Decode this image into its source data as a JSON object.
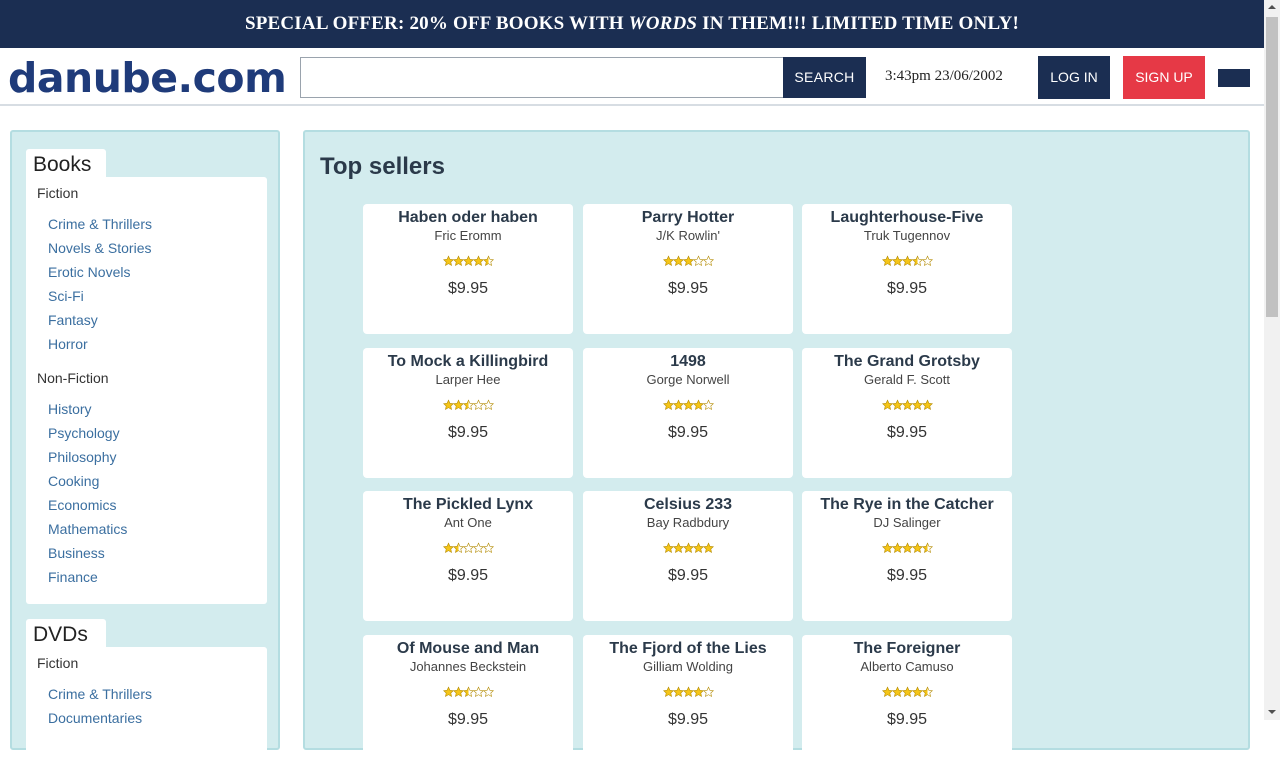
{
  "banner": {
    "pre": "SPECIAL OFFER: 20% OFF BOOKS WITH ",
    "emphasis": "WORDS",
    "post": " IN THEM!!! LIMITED TIME ONLY!"
  },
  "header": {
    "logo": "danube.com",
    "search_value": "",
    "search_button": "SEARCH",
    "clock": "3:43pm 23/06/2002",
    "login": "LOG IN",
    "signup": "SIGN UP"
  },
  "colors": {
    "navy": "#1b2e52",
    "signup_red": "#e63946",
    "panel_bg": "#d3ecee",
    "link_blue": "#3b6fa0",
    "star_gold": "#f5c518"
  },
  "sidebar": {
    "books": {
      "title": "Books",
      "fiction_label": "Fiction",
      "fiction": [
        "Crime & Thrillers",
        "Novels & Stories",
        "Erotic Novels",
        "Sci-Fi",
        "Fantasy",
        "Horror"
      ],
      "nonfiction_label": "Non-Fiction",
      "nonfiction": [
        "History",
        "Psychology",
        "Philosophy",
        "Cooking",
        "Economics",
        "Mathematics",
        "Business",
        "Finance"
      ]
    },
    "dvds": {
      "title": "DVDs",
      "fiction_label": "Fiction",
      "fiction": [
        "Crime & Thrillers",
        "Documentaries"
      ]
    }
  },
  "main": {
    "title": "Top sellers",
    "books": [
      {
        "title": "Haben oder haben",
        "author": "Fric Eromm",
        "rating": 4.5,
        "price": "$9.95"
      },
      {
        "title": "Parry Hotter",
        "author": "J/K Rowlin'",
        "rating": 3,
        "price": "$9.95"
      },
      {
        "title": "Laughterhouse-Five",
        "author": "Truk Tugennov",
        "rating": 3.5,
        "price": "$9.95"
      },
      {
        "title": "To Mock a Killingbird",
        "author": "Larper Hee",
        "rating": 2.5,
        "price": "$9.95"
      },
      {
        "title": "1498",
        "author": "Gorge Norwell",
        "rating": 4,
        "price": "$9.95"
      },
      {
        "title": "The Grand Grotsby",
        "author": "Gerald F. Scott",
        "rating": 5,
        "price": "$9.95"
      },
      {
        "title": "The Pickled Lynx",
        "author": "Ant One",
        "rating": 1.5,
        "price": "$9.95"
      },
      {
        "title": "Celsius 233",
        "author": "Bay Radbdury",
        "rating": 5,
        "price": "$9.95"
      },
      {
        "title": "The Rye in the Catcher",
        "author": "DJ Salinger",
        "rating": 4.5,
        "price": "$9.95"
      },
      {
        "title": "Of Mouse and Man",
        "author": "Johannes Beckstein",
        "rating": 2.5,
        "price": "$9.95"
      },
      {
        "title": "The Fjord of the Lies",
        "author": "Gilliam Wolding",
        "rating": 4,
        "price": "$9.95"
      },
      {
        "title": "The Foreigner",
        "author": "Alberto Camuso",
        "rating": 4.5,
        "price": "$9.95"
      }
    ]
  }
}
